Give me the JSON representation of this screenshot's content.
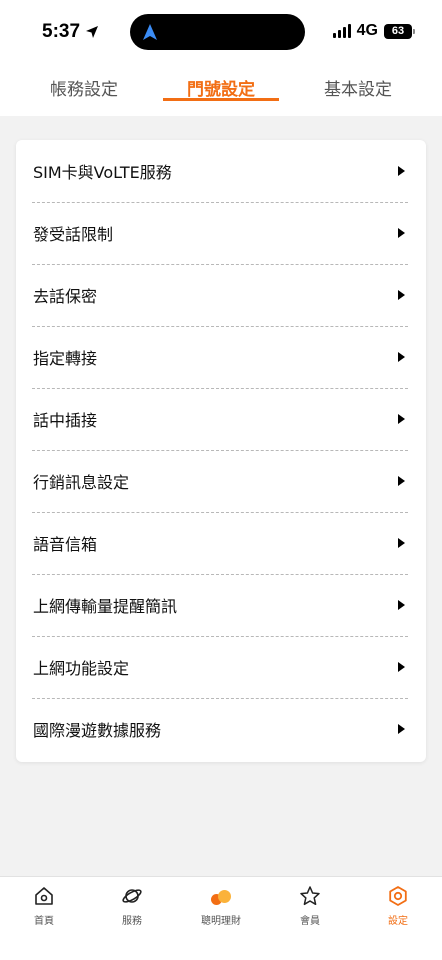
{
  "status_bar": {
    "time": "5:37",
    "network": "4G",
    "battery": "63"
  },
  "tabs": [
    {
      "label": "帳務設定",
      "active": false
    },
    {
      "label": "門號設定",
      "active": true
    },
    {
      "label": "基本設定",
      "active": false
    }
  ],
  "menu": {
    "items": [
      {
        "label": "SIM卡與VoLTE服務"
      },
      {
        "label": "發受話限制"
      },
      {
        "label": "去話保密"
      },
      {
        "label": "指定轉接"
      },
      {
        "label": "話中插接"
      },
      {
        "label": "行銷訊息設定"
      },
      {
        "label": "語音信箱"
      },
      {
        "label": "上網傳輸量提醒簡訊"
      },
      {
        "label": "上網功能設定"
      },
      {
        "label": "國際漫遊數據服務"
      }
    ]
  },
  "bottom_nav": {
    "items": [
      {
        "label": "首頁",
        "icon": "home-icon",
        "active": false
      },
      {
        "label": "服務",
        "icon": "planet-icon",
        "active": false
      },
      {
        "label": "聰明理財",
        "icon": "coins-icon",
        "active": false
      },
      {
        "label": "會員",
        "icon": "star-icon",
        "active": false
      },
      {
        "label": "設定",
        "icon": "gear-icon",
        "active": true
      }
    ]
  },
  "colors": {
    "accent": "#f26e14",
    "background": "#f2f2f2",
    "card": "#ffffff"
  }
}
